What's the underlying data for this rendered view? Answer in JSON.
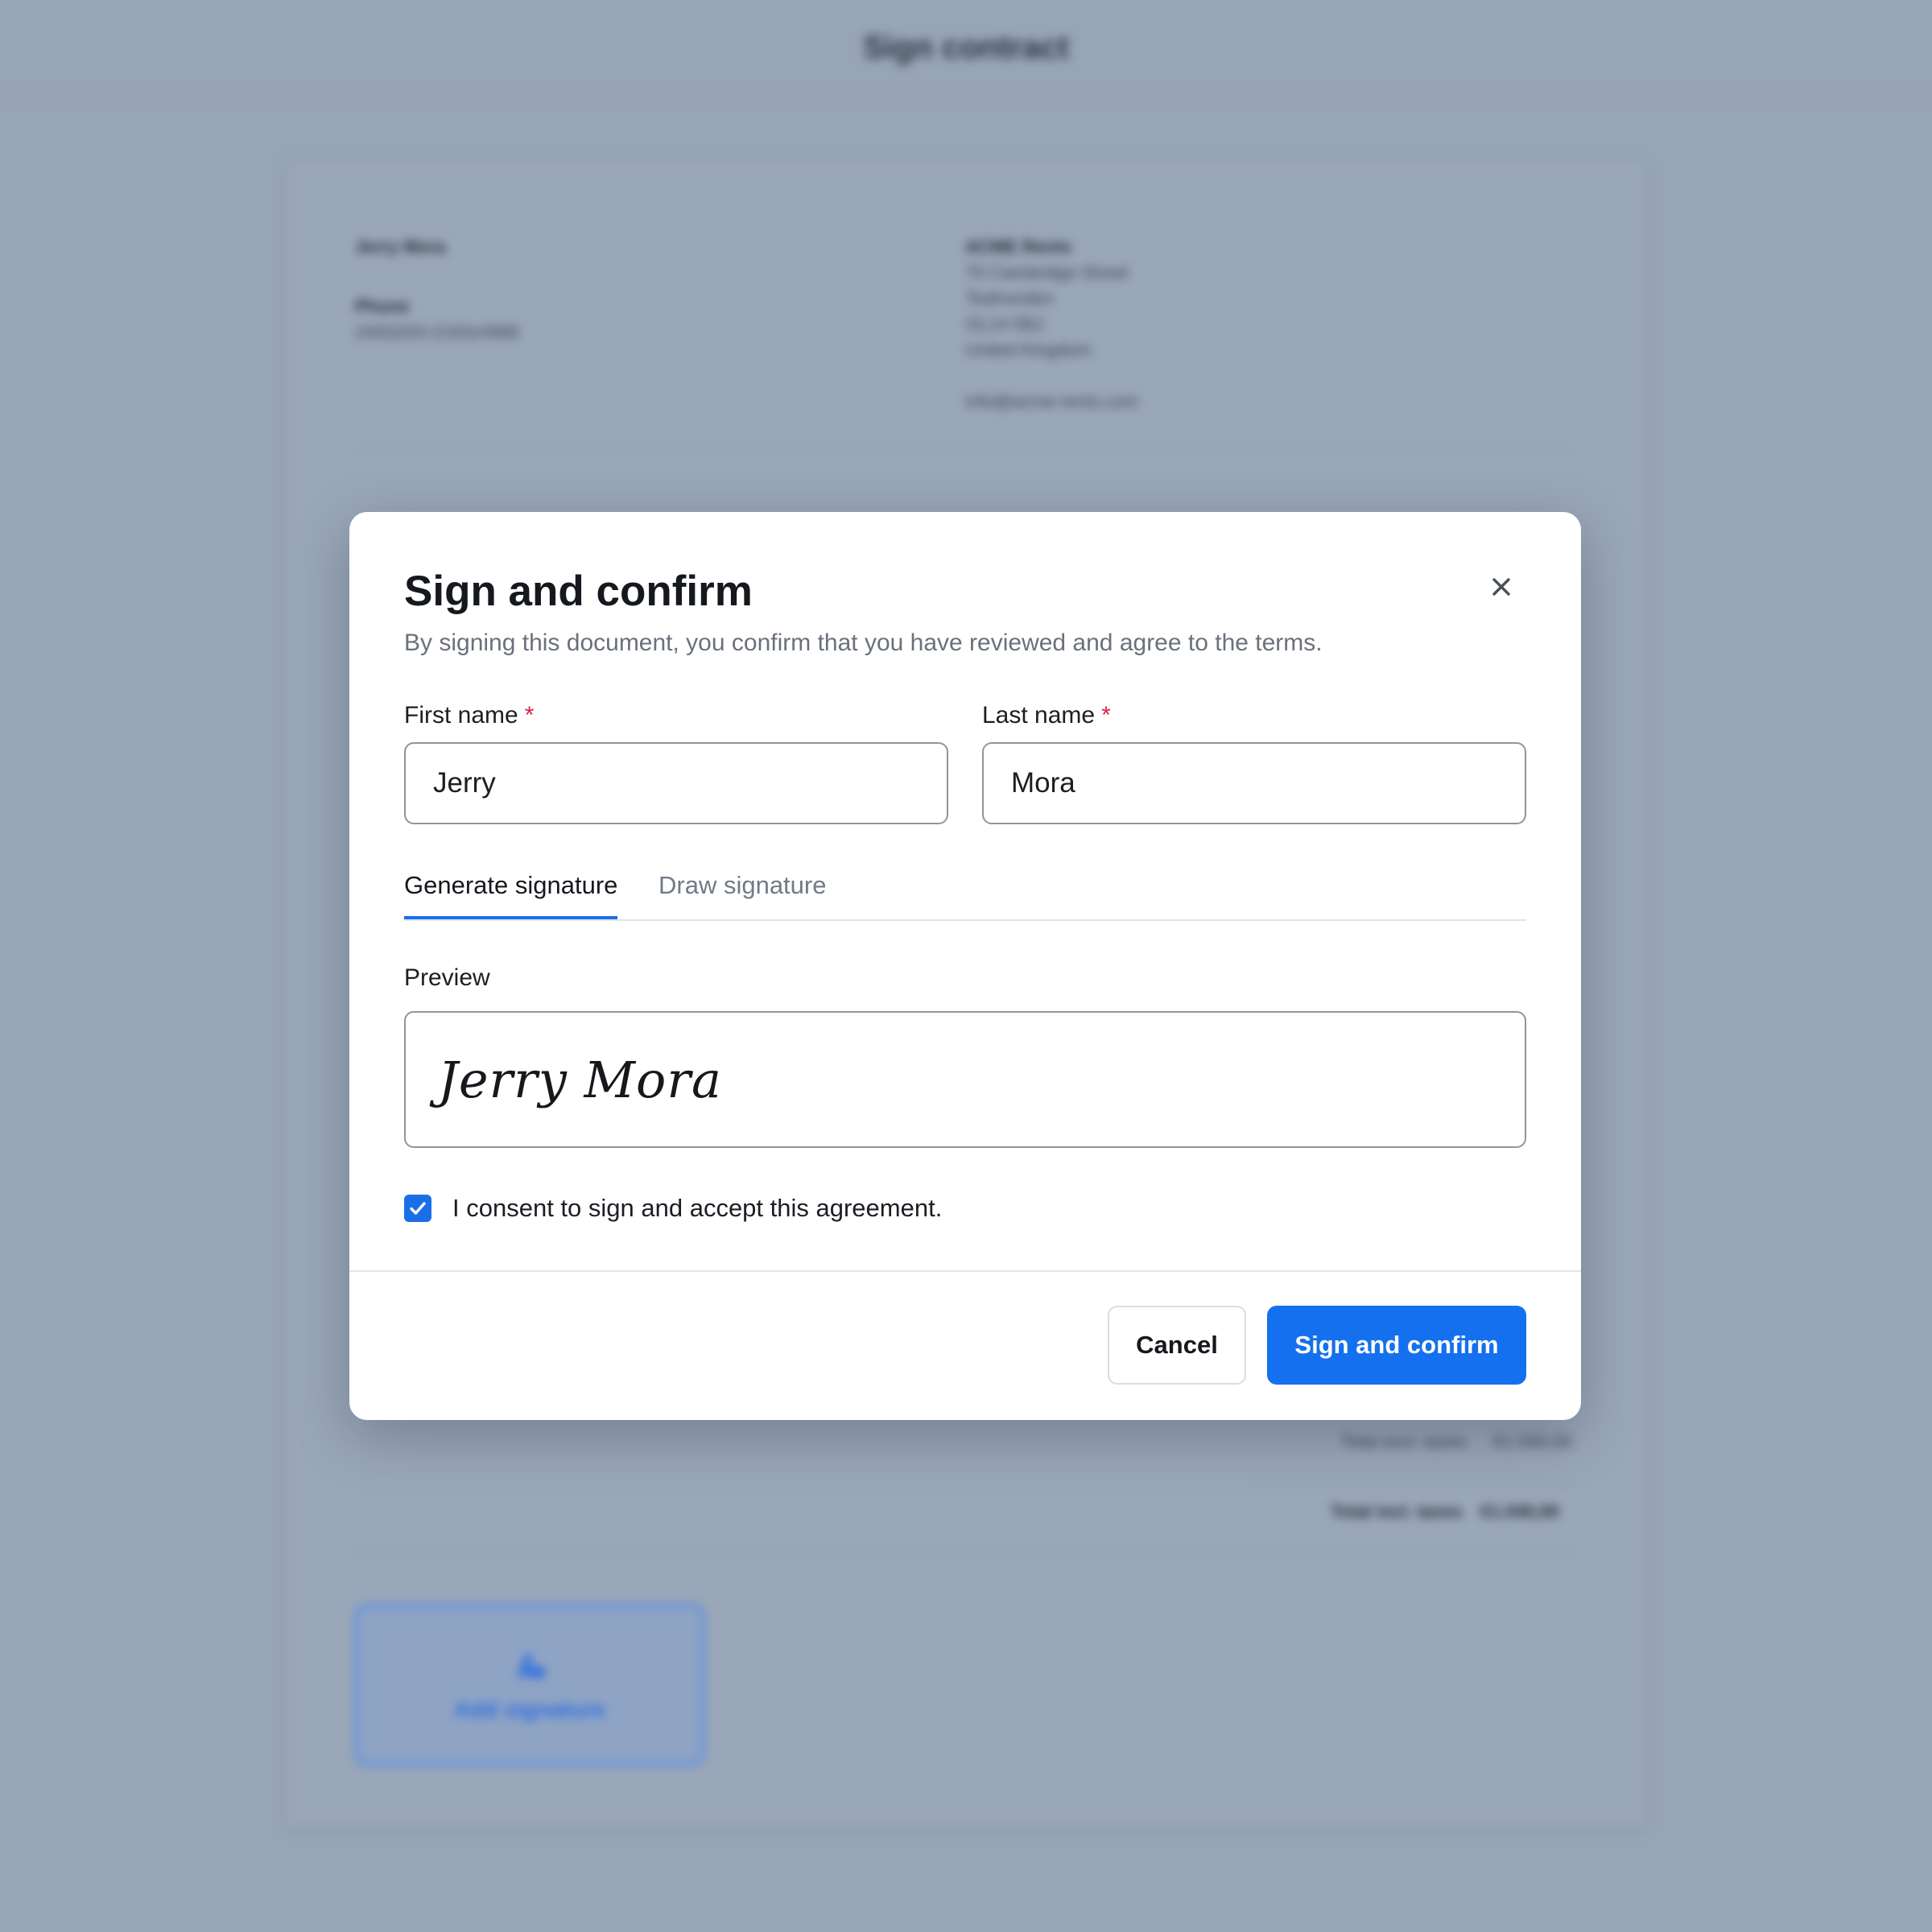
{
  "background": {
    "page_title": "Sign contract",
    "customer": {
      "name": "Jerry Mora",
      "phone_label": "Phone",
      "phone_value": "(440)203-2163x4986"
    },
    "company": {
      "name": "ACME Rents",
      "address": [
        "70 Cambridge Street",
        "Todmorden",
        "OL14 5BJ",
        "United Kingdom"
      ],
      "email": "info@acme-rents.com"
    },
    "totals": {
      "excl_label": "Total excl. taxes",
      "excl_value": "€1.040,00",
      "incl_label": "Total incl. taxes",
      "incl_value": "€1.040,00"
    },
    "add_signature_label": "Add signature",
    "add_signature_icon": "signature-pen-icon"
  },
  "modal": {
    "title": "Sign and confirm",
    "subtitle": "By signing this document, you confirm that you have reviewed and agree to the terms.",
    "close_icon": "close-icon",
    "first_name": {
      "label": "First name",
      "required_mark": "*",
      "value": "Jerry"
    },
    "last_name": {
      "label": "Last name",
      "required_mark": "*",
      "value": "Mora"
    },
    "tabs": [
      {
        "label": "Generate signature",
        "active": true
      },
      {
        "label": "Draw signature",
        "active": false
      }
    ],
    "preview_label": "Preview",
    "preview_signature": "Jerry Mora",
    "consent": {
      "checked": true,
      "label": "I consent to sign and accept this agreement."
    },
    "buttons": {
      "cancel": "Cancel",
      "confirm": "Sign and confirm"
    }
  },
  "colors": {
    "primary": "#1470ef",
    "required": "#d8244a",
    "overlay": "#98a5b6"
  }
}
